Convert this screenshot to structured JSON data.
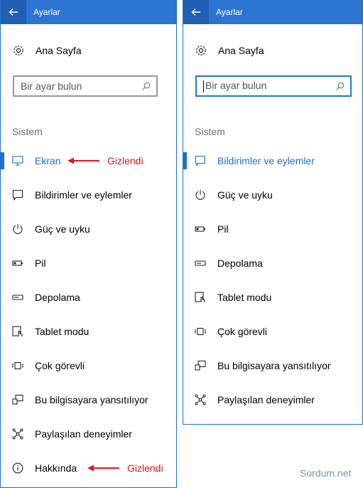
{
  "left": {
    "title": "Ayarlar",
    "home_label": "Ana Sayfa",
    "search_placeholder": "Bir ayar bulun",
    "section_label": "Sistem",
    "items": [
      {
        "label": "Ekran",
        "icon": "monitor-icon",
        "active": true,
        "annotation": "Gizlendi"
      },
      {
        "label": "Bildirimler ve eylemler",
        "icon": "notification-icon"
      },
      {
        "label": "Güç ve uyku",
        "icon": "power-icon"
      },
      {
        "label": "Pil",
        "icon": "battery-icon"
      },
      {
        "label": "Depolama",
        "icon": "storage-icon"
      },
      {
        "label": "Tablet modu",
        "icon": "tablet-mode-icon"
      },
      {
        "label": "Çok görevli",
        "icon": "multitasking-icon"
      },
      {
        "label": "Bu bilgisayara yansıtılıyor",
        "icon": "projecting-icon"
      },
      {
        "label": "Paylaşılan deneyimler",
        "icon": "shared-experiences-icon"
      },
      {
        "label": "Hakkında",
        "icon": "info-icon",
        "annotation": "Gizlendi"
      }
    ]
  },
  "right": {
    "title": "Ayarlar",
    "home_label": "Ana Sayfa",
    "search_placeholder": "Bir ayar bulun",
    "section_label": "Sistem",
    "items": [
      {
        "label": "Bildirimler ve eylemler",
        "icon": "notification-icon",
        "active": true
      },
      {
        "label": "Güç ve uyku",
        "icon": "power-icon"
      },
      {
        "label": "Pil",
        "icon": "battery-icon"
      },
      {
        "label": "Depolama",
        "icon": "storage-icon"
      },
      {
        "label": "Tablet modu",
        "icon": "tablet-mode-icon"
      },
      {
        "label": "Çok görevli",
        "icon": "multitasking-icon"
      },
      {
        "label": "Bu bilgisayara yansıtılıyor",
        "icon": "projecting-icon"
      },
      {
        "label": "Paylaşılan deneyimler",
        "icon": "shared-experiences-icon"
      }
    ]
  },
  "watermark": "Sordum.net",
  "colors": {
    "accent": "#2b74d2",
    "annotation": "#e0161d"
  }
}
